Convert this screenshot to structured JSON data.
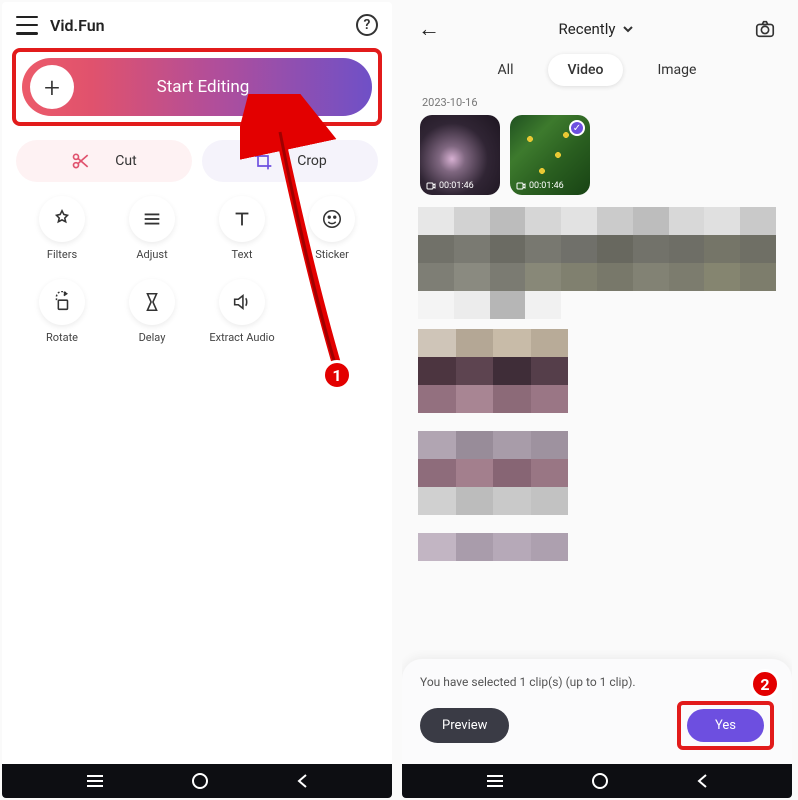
{
  "annotations": {
    "step1": "1",
    "step2": "2"
  },
  "left": {
    "app_title": "Vid.Fun",
    "start_editing": "Start Editing",
    "cut": "Cut",
    "crop": "Crop",
    "tools": {
      "filters": "Filters",
      "adjust": "Adjust",
      "text": "Text",
      "sticker": "Sticker",
      "rotate": "Rotate",
      "delay": "Delay",
      "extract_audio": "Extract Audio"
    }
  },
  "right": {
    "dropdown": "Recently",
    "tabs": {
      "all": "All",
      "video": "Video",
      "image": "Image"
    },
    "date": "2023-10-16",
    "clip_duration_1": "00:01:46",
    "clip_duration_2": "00:01:46",
    "selection_text": "You have selected 1 clip(s) (up to 1 clip).",
    "preview": "Preview",
    "yes": "Yes"
  }
}
